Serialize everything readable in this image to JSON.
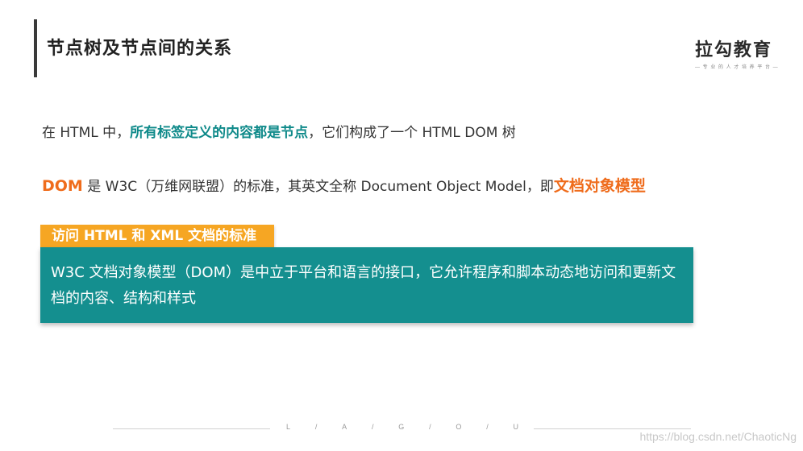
{
  "header": {
    "title": "节点树及节点间的关系",
    "logo_text": "拉勾教育",
    "logo_subtitle": "— 专 业 的 人 才 培 养 平 台 —"
  },
  "content": {
    "line1": {
      "prefix": "在 HTML 中，",
      "highlight": "所有标签定义的内容都是节点",
      "suffix": "，它们构成了一个 HTML DOM 树"
    },
    "line2": {
      "dom": "DOM",
      "middle": " 是 W3C（万维网联盟）的标准，其英文全称 Document Object Model，即",
      "highlight": "文档对象模型"
    },
    "tag_label": "访问 HTML 和 XML 文档的标准",
    "card_text": "W3C 文档对象模型（DOM）是中立于平台和语言的接口，它允许程序和脚本动态地访问和更新文档的内容、结构和样式"
  },
  "footer": {
    "letters": [
      "L",
      "/",
      "A",
      "/",
      "G",
      "/",
      "O",
      "/",
      "U"
    ]
  },
  "watermark": "https://blog.csdn.net/ChaoticNg",
  "colors": {
    "teal": "#148f8f",
    "orange_text": "#ef6c1c",
    "tag_orange": "#f6a623"
  }
}
